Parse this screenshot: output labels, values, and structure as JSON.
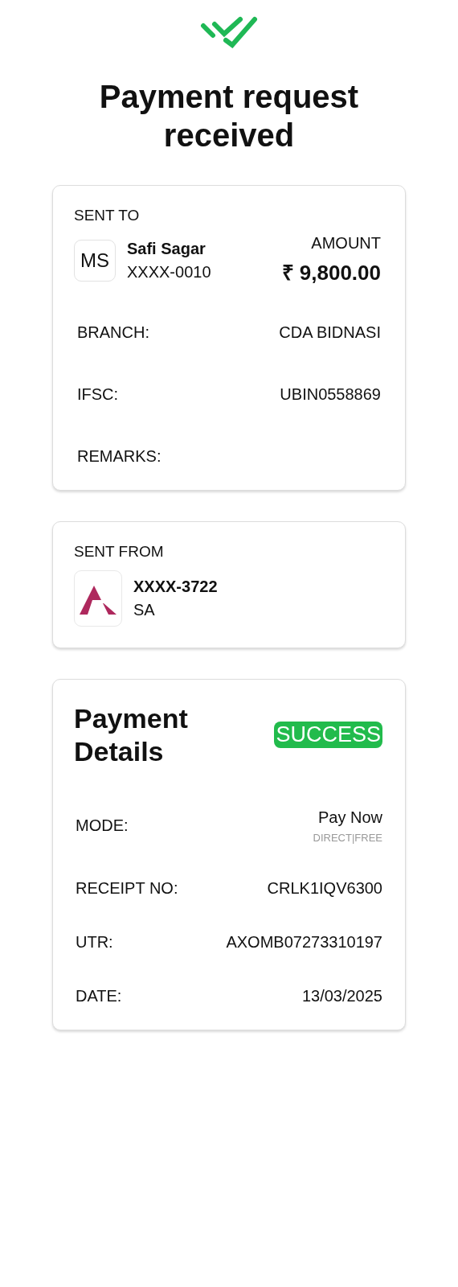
{
  "header": {
    "title": "Payment request received"
  },
  "sent_to": {
    "heading": "SENT TO",
    "avatar": "MS",
    "name": "Safi Sagar",
    "account": "XXXX-0010",
    "amount_label": "AMOUNT",
    "amount": "₹ 9,800.00",
    "details": [
      {
        "label": "BRANCH:",
        "value": "CDA BIDNASI"
      },
      {
        "label": "IFSC:",
        "value": "UBIN0558869"
      },
      {
        "label": "REMARKS:"
      }
    ]
  },
  "sent_from": {
    "heading": "SENT FROM",
    "account": "XXXX-3722",
    "name": "SA"
  },
  "payment_details": {
    "title": "Payment Details",
    "status": "SUCCESS",
    "rows": [
      {
        "label": "MODE:",
        "value": "Pay Now",
        "note": "DIRECT|FREE"
      },
      {
        "label": "RECEIPT NO:",
        "value": "CRLK1IQV6300"
      },
      {
        "label": "UTR:",
        "value": "AXOMB07273310197"
      },
      {
        "label": "DATE:",
        "value": "13/03/2025"
      }
    ]
  }
}
